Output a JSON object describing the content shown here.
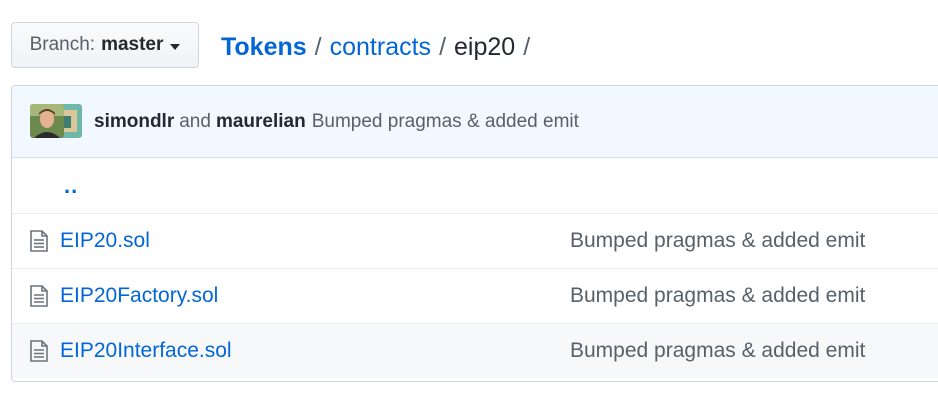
{
  "branch": {
    "label": "Branch:",
    "value": "master"
  },
  "breadcrumb": {
    "repo": "Tokens",
    "separator": "/",
    "folders": [
      "contracts"
    ],
    "current": "eip20"
  },
  "commit": {
    "author1": "simondlr",
    "conjunction": "and",
    "author2": "maurelian",
    "message": "Bumped pragmas & added emit"
  },
  "parent_dir": "..",
  "files": [
    {
      "name": "EIP20.sol",
      "message": "Bumped pragmas & added emit",
      "icon": "file-text-icon"
    },
    {
      "name": "EIP20Factory.sol",
      "message": "Bumped pragmas & added emit",
      "icon": "file-text-icon"
    },
    {
      "name": "EIP20Interface.sol",
      "message": "Bumped pragmas & added emit",
      "icon": "file-text-icon"
    }
  ],
  "colors": {
    "link": "#0366d6",
    "muted": "#586069",
    "commit_bar_bg": "#f1f8ff"
  }
}
